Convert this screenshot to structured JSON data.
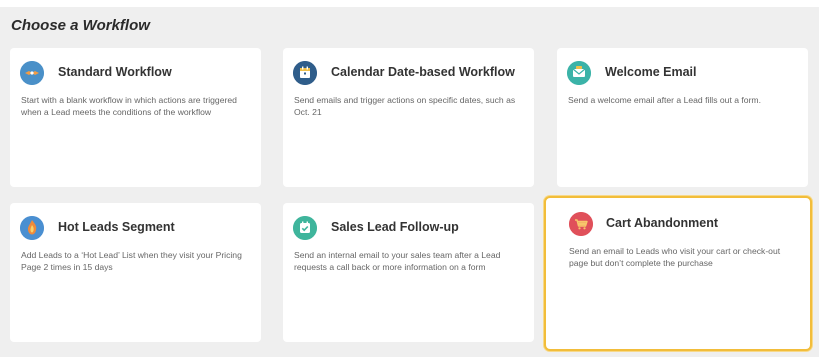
{
  "page_title": "Choose a Workflow",
  "cards": [
    {
      "title": "Standard Workflow",
      "description": "Start with a blank workflow in which actions are triggered when a Lead meets the conditions of the workflow",
      "icon": "standard-workflow-icon",
      "icon_color": "#4a90c8"
    },
    {
      "title": "Calendar Date-based Workflow",
      "description": "Send emails and trigger actions on specific dates, such as Oct. 21",
      "icon": "calendar-icon",
      "icon_color": "#2f5d8a"
    },
    {
      "title": "Welcome Email",
      "description": "Send a welcome email after a Lead fills out a form.",
      "icon": "welcome-email-icon",
      "icon_color": "#3bb3a8"
    },
    {
      "title": "Hot Leads Segment",
      "description": "Add Leads to a ‘Hot Lead’ List when they visit your Pricing Page 2 times in 15 days",
      "icon": "hot-leads-icon",
      "icon_color": "#4a8fd1"
    },
    {
      "title": "Sales Lead Follow-up",
      "description": "Send an internal email to your sales team after a Lead requests a call back or more information on a form",
      "icon": "follow-up-icon",
      "icon_color": "#3fb59c"
    },
    {
      "title": "Cart Abandonment",
      "description": "Send an email to Leads who visit your cart or check-out page but don’t complete the purchase",
      "icon": "cart-icon",
      "icon_color": "#e0505a",
      "selected": true
    }
  ],
  "colors": {
    "background": "#efefef",
    "card": "#ffffff",
    "selected_border": "#f2bd3a"
  }
}
